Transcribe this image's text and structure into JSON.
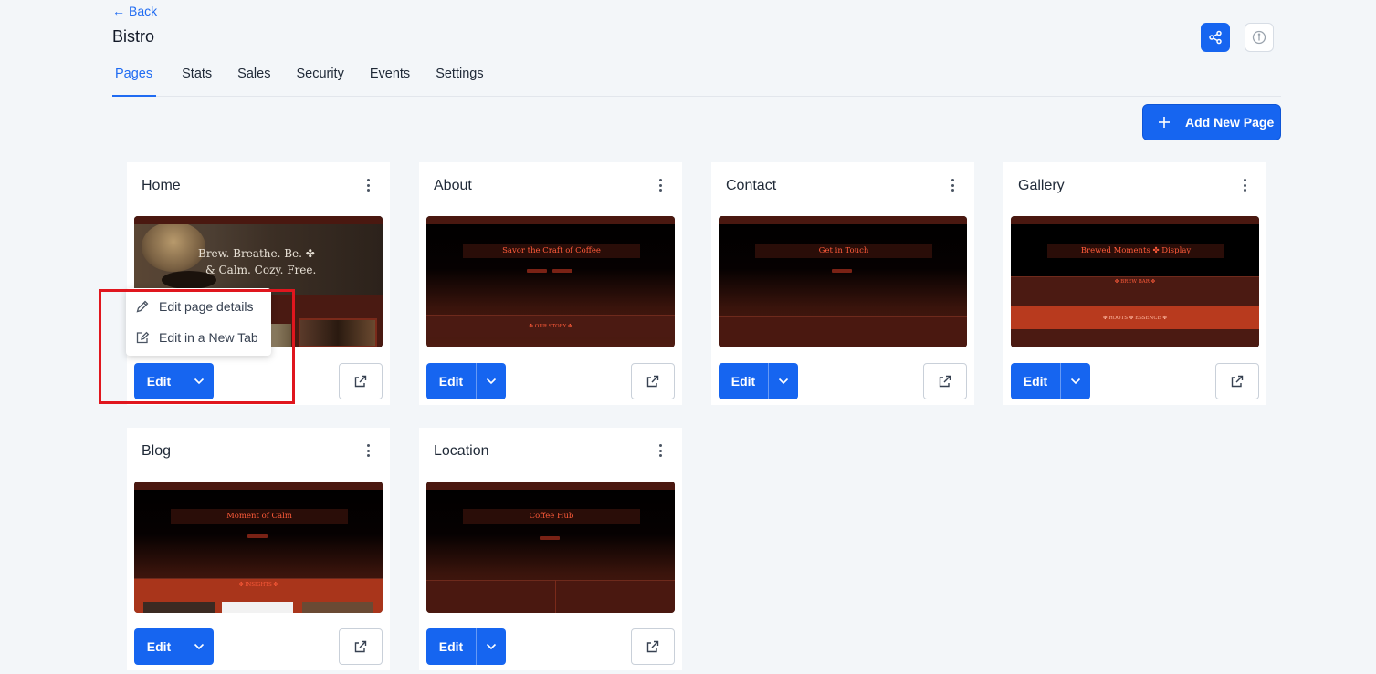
{
  "header": {
    "back_label": "Back",
    "site_title": "Bistro"
  },
  "tabs": [
    {
      "label": "Pages",
      "active": true
    },
    {
      "label": "Stats"
    },
    {
      "label": "Sales"
    },
    {
      "label": "Security"
    },
    {
      "label": "Events"
    },
    {
      "label": "Settings"
    }
  ],
  "add_page_label": "Add New Page",
  "cards": [
    {
      "title": "Home",
      "edit_label": "Edit",
      "thumb": {
        "line1": "Brew. Breathe. Be. ✤",
        "line2": "& Calm. Cozy. Free."
      }
    },
    {
      "title": "About",
      "edit_label": "Edit",
      "thumb": {
        "banner": "Savor the Craft of Coffee",
        "strip": "✤ OUR STORY ✤"
      }
    },
    {
      "title": "Contact",
      "edit_label": "Edit",
      "thumb": {
        "banner": "Get in Touch"
      }
    },
    {
      "title": "Gallery",
      "edit_label": "Edit",
      "thumb": {
        "banner": "Brewed Moments ✤ Display",
        "strip": "✤ BREW BAR ✤",
        "strip2": "✤ ROOTS ✤ ESSENCE ✤"
      }
    },
    {
      "title": "Blog",
      "edit_label": "Edit",
      "thumb": {
        "banner": "Moment of Calm",
        "strip": "✤ INSIGHTS ✤"
      }
    },
    {
      "title": "Location",
      "edit_label": "Edit",
      "thumb": {
        "banner": "Coffee Hub"
      }
    }
  ],
  "dropdown": {
    "items": [
      {
        "label": "Edit page details"
      },
      {
        "label": "Edit in a New Tab"
      }
    ]
  },
  "colors": {
    "primary": "#1665f0",
    "background": "#f3f6f9",
    "highlight": "#e0161e",
    "thumb_accent": "#ff5b3a"
  }
}
